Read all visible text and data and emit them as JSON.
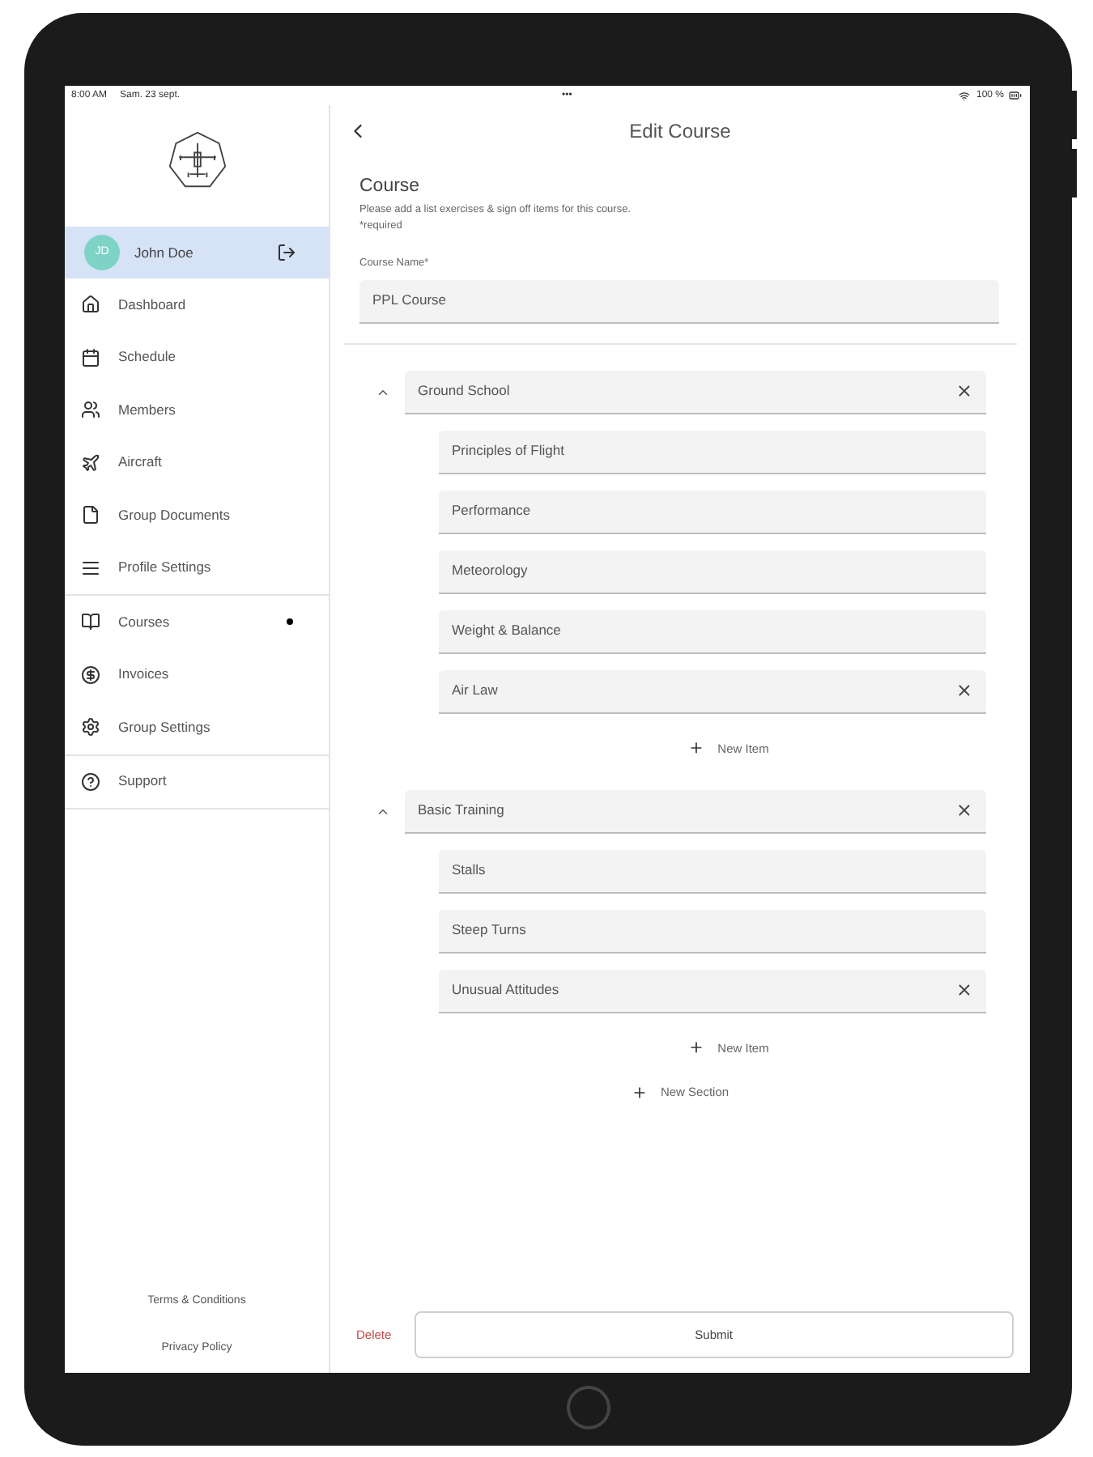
{
  "status_bar": {
    "time": "8:00 AM",
    "date": "Sam. 23 sept.",
    "dots": "•••",
    "battery": "100 %"
  },
  "sidebar": {
    "user": {
      "initials": "JD",
      "name": "John Doe",
      "selected": true
    },
    "groups": [
      [
        {
          "label": "Dashboard",
          "dot": false
        },
        {
          "label": "Schedule",
          "dot": false
        },
        {
          "label": "Members",
          "dot": false
        },
        {
          "label": "Aircraft",
          "dot": false
        },
        {
          "label": "Group Documents",
          "dot": false
        },
        {
          "label": "Profile Settings",
          "dot": false
        }
      ],
      [
        {
          "label": "Courses",
          "dot": true
        },
        {
          "label": "Invoices",
          "dot": false
        },
        {
          "label": "Group Settings",
          "dot": false
        }
      ],
      [
        {
          "label": "Support",
          "dot": false
        }
      ]
    ],
    "footer_links": [
      "Terms & Conditions",
      "Privacy Policy"
    ]
  },
  "header": {
    "title": "Edit Course"
  },
  "form": {
    "title": "Course",
    "description": "Please add a list exercises & sign off items for this course.",
    "required_note": "*required",
    "course_name_label": "Course Name*",
    "course_name": "PPL Course",
    "sections": [
      {
        "name": "Ground School",
        "expanded": true,
        "removable": true,
        "items": [
          {
            "name": "Principles of Flight",
            "removable": false
          },
          {
            "name": "Performance",
            "removable": false
          },
          {
            "name": "Meteorology",
            "removable": false
          },
          {
            "name": "Weight & Balance",
            "removable": false
          },
          {
            "name": "Air Law",
            "removable": true
          }
        ],
        "new_item": "New Item"
      },
      {
        "name": "Basic Training",
        "expanded": true,
        "removable": true,
        "items": [
          {
            "name": "Stalls",
            "removable": false
          },
          {
            "name": "Steep Turns",
            "removable": false
          },
          {
            "name": "Unusual Attitudes",
            "removable": true
          }
        ],
        "new_item": "New Item"
      }
    ],
    "new_section": "New Section"
  },
  "actions": {
    "delete": "Delete",
    "submit": "Submit"
  }
}
